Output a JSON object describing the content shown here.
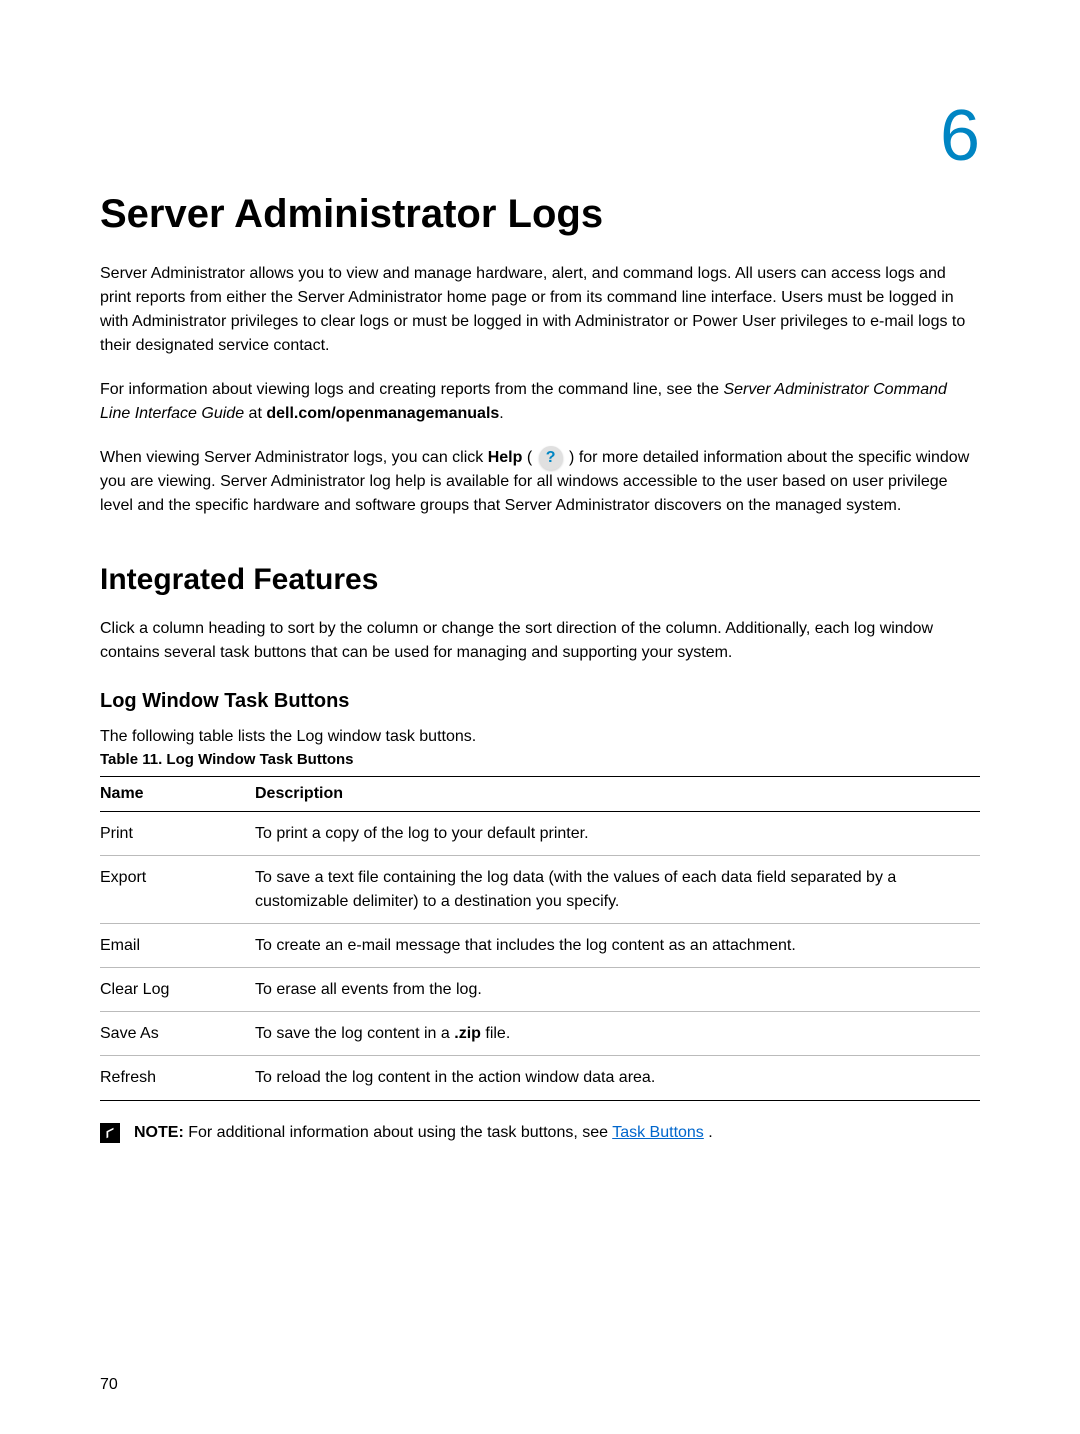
{
  "chapter_number": "6",
  "title": "Server Administrator Logs",
  "paragraph1": "Server Administrator allows you to view and manage hardware, alert, and command logs. All users can access logs and print reports from either the Server Administrator home page or from its command line interface. Users must be logged in with Administrator privileges to clear logs or must be logged in with Administrator or Power User privileges to e-mail logs to their designated service contact.",
  "paragraph2_prefix": "For information about viewing logs and creating reports from the command line, see the ",
  "paragraph2_italic": "Server Administrator Command Line Interface Guide",
  "paragraph2_at": " at ",
  "paragraph2_bold": "dell.com/openmanagemanuals",
  "paragraph2_suffix": ".",
  "paragraph3_pre": "When viewing Server Administrator logs, you can click ",
  "paragraph3_help_bold": "Help",
  "paragraph3_open_paren": " ( ",
  "paragraph3_close_paren": " ) ",
  "paragraph3_post": "for more detailed information about the specific window you are viewing. Server Administrator log help is available for all windows accessible to the user based on user privilege level and the specific hardware and software groups that Server Administrator discovers on the managed system.",
  "section2_title": "Integrated Features",
  "section2_para": "Click a column heading to sort by the column or change the sort direction of the column. Additionally, each log window contains several task buttons that can be used for managing and supporting your system.",
  "section3_title": "Log Window Task Buttons",
  "table_intro": "The following table lists the Log window task buttons.",
  "table_caption": "Table 11. Log Window Task Buttons",
  "table": {
    "headers": [
      "Name",
      "Description"
    ],
    "rows": [
      {
        "name": "Print",
        "desc": "To print a copy of the log to your default printer."
      },
      {
        "name": "Export",
        "desc": "To save a text file containing the log data (with the values of each data field separated by a customizable delimiter) to a destination you specify."
      },
      {
        "name": "Email",
        "desc": "To create an e-mail message that includes the log content as an attachment."
      },
      {
        "name": "Clear Log",
        "desc": "To erase all events from the log."
      },
      {
        "name": "Save As",
        "desc_pre": "To save the log content in a ",
        "desc_bold": ".zip",
        "desc_post": " file."
      },
      {
        "name": "Refresh",
        "desc": "To reload the log content in the action window data area."
      }
    ]
  },
  "note_label": "NOTE:",
  "note_text": " For additional information about using the task buttons, see ",
  "note_link": "Task Buttons",
  "note_suffix": " .",
  "page_number": "70"
}
